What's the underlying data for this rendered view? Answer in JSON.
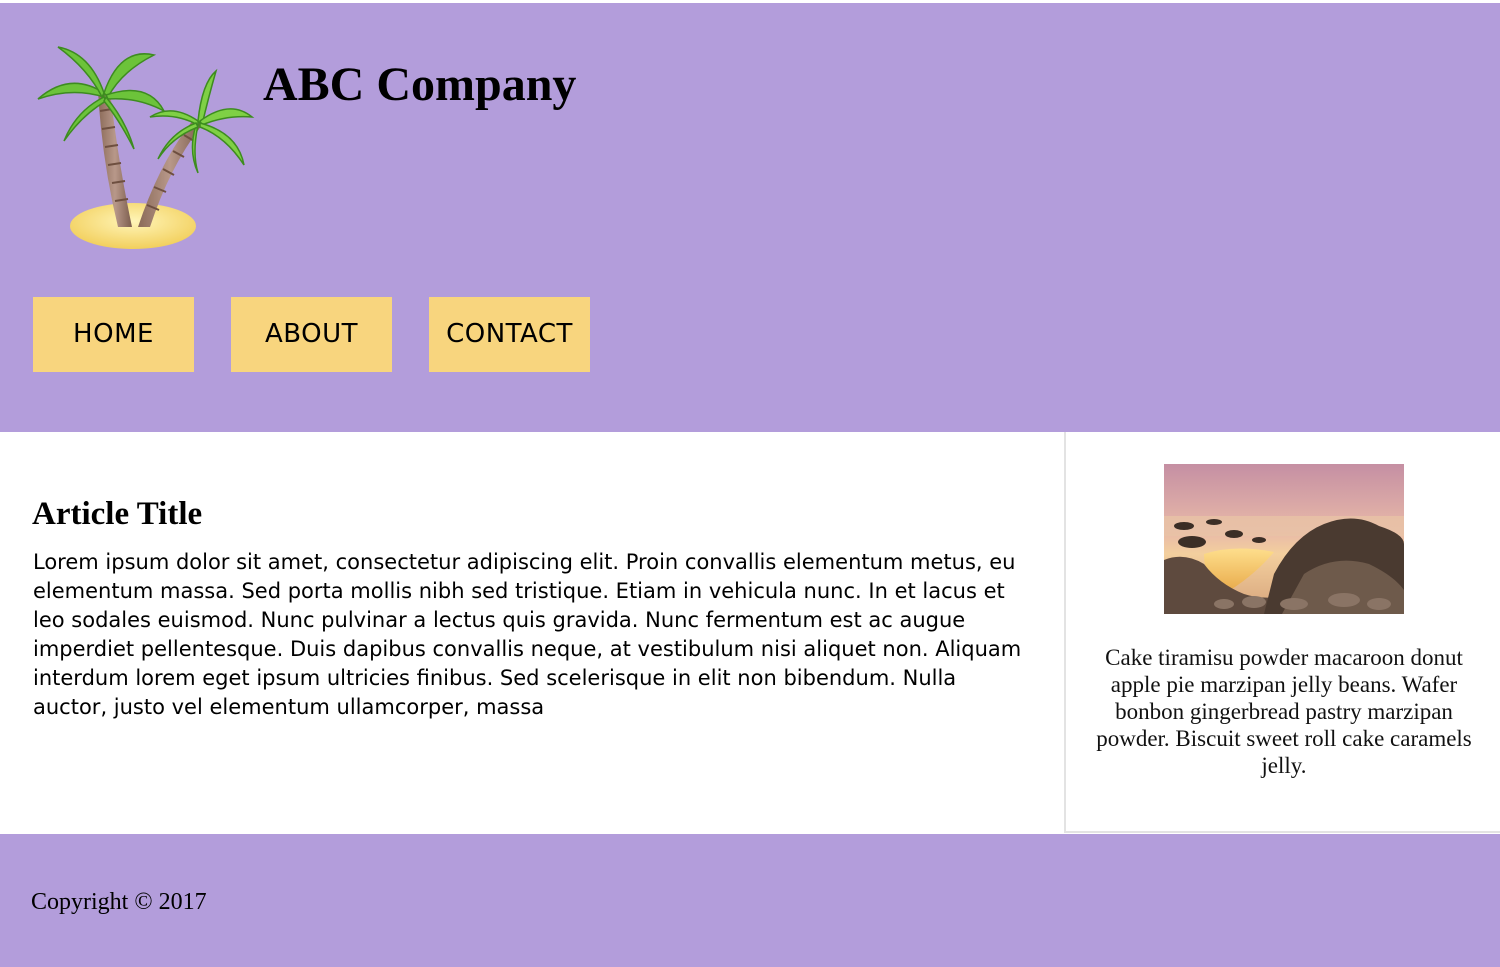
{
  "header": {
    "logo_icon": "palm-tree-island-icon",
    "title": "ABC Company",
    "background_color": "#b39ddb"
  },
  "nav": {
    "items": [
      {
        "label": "HOME"
      },
      {
        "label": "ABOUT"
      },
      {
        "label": "CONTACT"
      }
    ],
    "button_color": "#f8d57e"
  },
  "article": {
    "title": "Article Title",
    "body": "Lorem ipsum dolor sit amet, consectetur adipiscing elit. Proin convallis elementum metus, eu elementum massa. Sed porta mollis nibh sed tristique. Etiam in vehicula nunc. In et lacus et leo sodales euismod. Nunc pulvinar a lectus quis gravida. Nunc fermentum est ac augue imperdiet pellentesque. Duis dapibus convallis neque, at vestibulum nisi aliquet non. Aliquam interdum lorem eget ipsum ultricies finibus. Sed scelerisque in elit non bibendum. Nulla auctor, justo vel elementum ullamcorper, massa"
  },
  "aside": {
    "image_icon": "coastal-rocks-sunset-photo",
    "text": "Cake tiramisu powder macaroon donut apple pie marzipan jelly beans. Wafer bonbon gingerbread pastry marzipan powder. Biscuit sweet roll cake caramels jelly."
  },
  "footer": {
    "copyright": "Copyright © 2017"
  }
}
